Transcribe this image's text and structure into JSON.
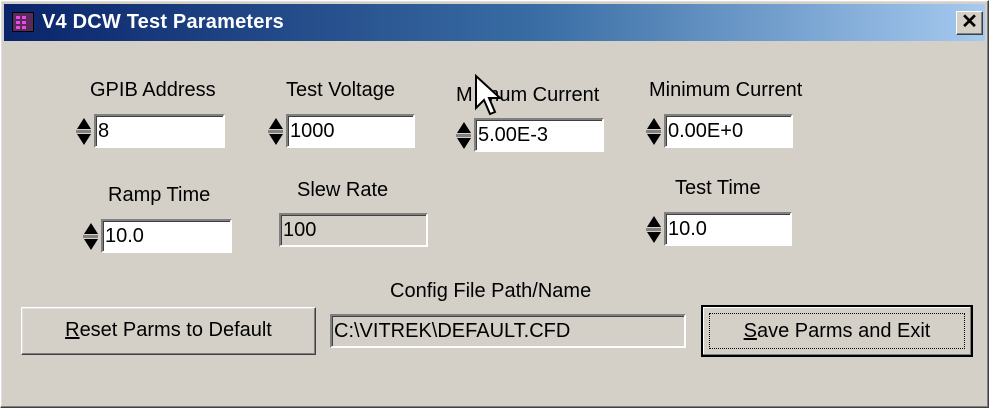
{
  "window": {
    "title": "V4 DCW Test Parameters",
    "close_glyph": "✕"
  },
  "fields": {
    "gpib_address": {
      "label": "GPIB Address",
      "value": "8"
    },
    "test_voltage": {
      "label": "Test Voltage",
      "value": "1000"
    },
    "maximum_current": {
      "label": "M  imum Current",
      "value": "5.00E-3"
    },
    "minimum_current": {
      "label": "Minimum Current",
      "value": "0.00E+0"
    },
    "ramp_time": {
      "label": "Ramp Time",
      "value": "10.0"
    },
    "slew_rate": {
      "label": "Slew Rate",
      "value": "100"
    },
    "test_time": {
      "label": "Test Time",
      "value": "10.0"
    },
    "config_file": {
      "label": "Config File Path/Name",
      "value": "C:\\VITREK\\DEFAULT.CFD"
    }
  },
  "buttons": {
    "reset": {
      "label_underlined": "R",
      "label_rest": "eset Parms to Default"
    },
    "save": {
      "label_underlined": "S",
      "label_rest": "ave Parms and Exit"
    }
  },
  "icons": {
    "app": "app-icon",
    "close": "close-icon",
    "cursor": "mouse-pointer-icon",
    "spinner": "spinner-arrows-icon"
  }
}
